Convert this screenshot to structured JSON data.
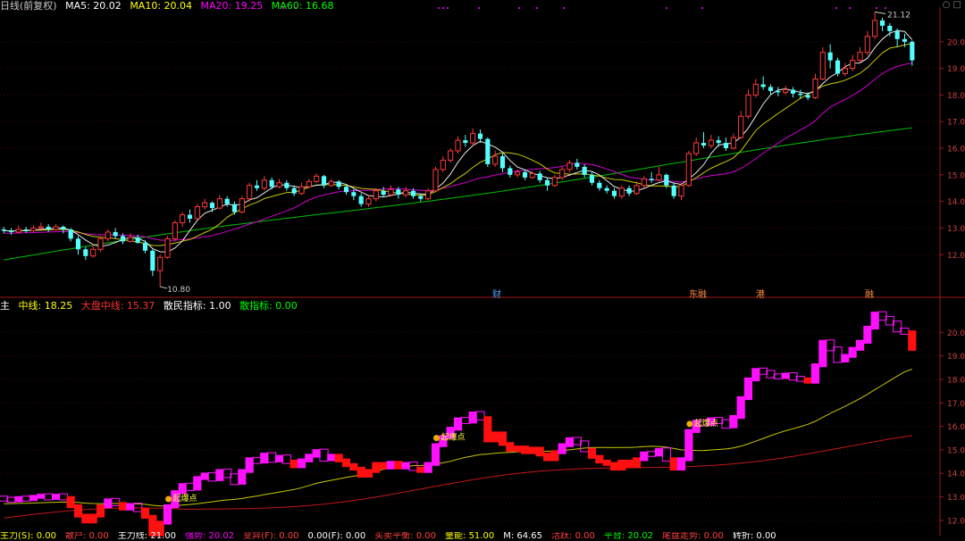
{
  "main_header": {
    "period": "日线(前复权)",
    "ma5": "MA5: 20.02",
    "ma10": "MA10: 20.04",
    "ma20": "MA20: 19.25",
    "ma60": "MA60: 16.68",
    "colors": {
      "period": "#c8c8c8",
      "ma5": "#ffffff",
      "ma10": "#ffff00",
      "ma20": "#ff00ff",
      "ma60": "#00ff00"
    }
  },
  "sub_header": {
    "name": "主",
    "mid": "中线: 18.25",
    "big": "大盘中线: 15.37",
    "retail": "散民指标: 1.00",
    "main_force": "散指标: 0.00",
    "colors": {
      "mid": "#ffff00",
      "big": "#ff3030",
      "retail": "#ffffff",
      "main_force": "#00ff00"
    }
  },
  "event_tags": [
    {
      "label": "财",
      "color": "#4fa3ff"
    },
    {
      "label": "东融",
      "color": "#ff8c40"
    },
    {
      "label": "港",
      "color": "#ff8c40"
    },
    {
      "label": "融",
      "color": "#ff8c40"
    }
  ],
  "annotations": {
    "high": "21.12",
    "low": "10.80",
    "signal_label": "起爆点"
  },
  "price_axis_main": [
    "20.00",
    "19.00",
    "18.00",
    "17.00",
    "16.00",
    "15.00",
    "14.00",
    "13.00",
    "12.00"
  ],
  "price_axis_sub": [
    "20.00",
    "19.00",
    "18.00",
    "17.00",
    "16.00",
    "15.00",
    "14.00",
    "13.00",
    "12.00"
  ],
  "bottom_bar": {
    "items": [
      "主力(S): 0.00",
      "散户: 0.00",
      "主力线: 21.00",
      "强势: 20.02",
      "变异(F): 0.00",
      "0.00(F): 0.00",
      "买卖平衡: 0.00",
      "量能: 51.00",
      "M: 64.65",
      "活跃: 0.00",
      "平台: 20.02",
      "尾盘走势: 0.00",
      "转折: 0.00"
    ]
  },
  "chart_data": {
    "type": "candlestick",
    "y_range_main": [
      10.5,
      21.3
    ],
    "y_range_sub": [
      11.5,
      21.0
    ],
    "candles": [
      [
        12.95,
        12.9,
        13.05,
        12.8
      ],
      [
        12.9,
        12.85,
        13.0,
        12.75
      ],
      [
        12.85,
        12.95,
        13.1,
        12.8
      ],
      [
        12.95,
        12.9,
        13.05,
        12.82
      ],
      [
        12.9,
        13.0,
        13.1,
        12.85
      ],
      [
        13.0,
        13.05,
        13.2,
        12.95
      ],
      [
        13.05,
        12.95,
        13.15,
        12.85
      ],
      [
        12.95,
        13.05,
        13.15,
        12.9
      ],
      [
        13.05,
        12.95,
        13.1,
        12.8
      ],
      [
        12.95,
        12.6,
        13.0,
        12.5
      ],
      [
        12.6,
        12.2,
        12.7,
        12.0
      ],
      [
        12.2,
        11.95,
        12.3,
        11.8
      ],
      [
        11.95,
        12.2,
        12.4,
        11.9
      ],
      [
        12.2,
        12.6,
        12.7,
        12.1
      ],
      [
        12.6,
        12.85,
        12.95,
        12.5
      ],
      [
        12.85,
        12.7,
        13.0,
        12.6
      ],
      [
        12.7,
        12.5,
        12.8,
        12.4
      ],
      [
        12.5,
        12.65,
        12.8,
        12.45
      ],
      [
        12.65,
        12.45,
        12.75,
        12.4
      ],
      [
        12.45,
        12.15,
        12.55,
        12.05
      ],
      [
        12.15,
        11.4,
        12.2,
        11.2
      ],
      [
        11.4,
        11.9,
        12.0,
        10.8
      ],
      [
        11.9,
        12.6,
        12.7,
        11.85
      ],
      [
        12.6,
        13.2,
        13.3,
        12.5
      ],
      [
        13.2,
        13.5,
        13.6,
        13.05
      ],
      [
        13.5,
        13.35,
        13.7,
        13.2
      ],
      [
        13.35,
        13.8,
        13.9,
        13.3
      ],
      [
        13.8,
        13.95,
        14.1,
        13.7
      ],
      [
        13.95,
        13.75,
        14.0,
        13.6
      ],
      [
        13.75,
        14.1,
        14.25,
        13.7
      ],
      [
        14.1,
        13.9,
        14.2,
        13.8
      ],
      [
        13.9,
        13.6,
        14.0,
        13.5
      ],
      [
        13.6,
        14.1,
        14.2,
        13.55
      ],
      [
        14.1,
        14.6,
        14.7,
        14.0
      ],
      [
        14.6,
        14.5,
        14.8,
        14.4
      ],
      [
        14.5,
        14.8,
        14.95,
        14.4
      ],
      [
        14.8,
        14.55,
        14.9,
        14.45
      ],
      [
        14.55,
        14.7,
        14.85,
        14.5
      ],
      [
        14.7,
        14.5,
        14.8,
        14.4
      ],
      [
        14.5,
        14.3,
        14.6,
        14.2
      ],
      [
        14.3,
        14.55,
        14.7,
        14.25
      ],
      [
        14.55,
        14.75,
        14.85,
        14.5
      ],
      [
        14.75,
        14.95,
        15.05,
        14.7
      ],
      [
        14.95,
        14.6,
        15.0,
        14.5
      ],
      [
        14.6,
        14.75,
        14.85,
        14.55
      ],
      [
        14.75,
        14.55,
        14.8,
        14.45
      ],
      [
        14.55,
        14.35,
        14.6,
        14.25
      ],
      [
        14.35,
        14.2,
        14.45,
        14.05
      ],
      [
        14.2,
        13.9,
        14.3,
        13.8
      ],
      [
        13.9,
        14.1,
        14.25,
        13.8
      ],
      [
        14.1,
        14.4,
        14.5,
        14.0
      ],
      [
        14.4,
        14.25,
        14.55,
        14.15
      ],
      [
        14.25,
        14.45,
        14.6,
        14.2
      ],
      [
        14.45,
        14.25,
        14.55,
        14.1
      ],
      [
        14.25,
        14.4,
        14.55,
        14.15
      ],
      [
        14.4,
        14.2,
        14.5,
        14.1
      ],
      [
        14.2,
        14.1,
        14.3,
        14.0
      ],
      [
        14.1,
        14.4,
        14.5,
        14.05
      ],
      [
        14.4,
        15.2,
        15.3,
        14.35
      ],
      [
        15.2,
        15.55,
        15.7,
        15.1
      ],
      [
        15.55,
        15.9,
        16.0,
        15.45
      ],
      [
        15.9,
        16.3,
        16.45,
        15.8
      ],
      [
        16.3,
        16.2,
        16.5,
        16.05
      ],
      [
        16.2,
        16.55,
        16.75,
        16.1
      ],
      [
        16.55,
        16.35,
        16.7,
        16.2
      ],
      [
        16.35,
        15.4,
        16.4,
        15.3
      ],
      [
        15.4,
        15.7,
        15.9,
        15.3
      ],
      [
        15.7,
        15.25,
        15.8,
        15.1
      ],
      [
        15.25,
        15.0,
        15.35,
        14.9
      ],
      [
        15.0,
        15.1,
        15.2,
        14.9
      ],
      [
        15.1,
        14.9,
        15.2,
        14.8
      ],
      [
        14.9,
        15.05,
        15.15,
        14.85
      ],
      [
        15.05,
        14.8,
        15.15,
        14.7
      ],
      [
        14.8,
        14.6,
        14.9,
        14.4
      ],
      [
        14.6,
        14.9,
        15.0,
        14.55
      ],
      [
        14.9,
        15.2,
        15.3,
        14.8
      ],
      [
        15.2,
        15.45,
        15.55,
        15.1
      ],
      [
        15.45,
        15.3,
        15.6,
        15.2
      ],
      [
        15.3,
        15.0,
        15.4,
        14.9
      ],
      [
        15.0,
        14.7,
        15.1,
        14.6
      ],
      [
        14.7,
        14.5,
        14.8,
        14.4
      ],
      [
        14.5,
        14.4,
        14.6,
        14.3
      ],
      [
        14.4,
        14.2,
        14.5,
        14.1
      ],
      [
        14.2,
        14.5,
        14.6,
        14.1
      ],
      [
        14.5,
        14.3,
        14.6,
        14.2
      ],
      [
        14.3,
        14.6,
        14.75,
        14.25
      ],
      [
        14.6,
        14.85,
        14.95,
        14.5
      ],
      [
        14.85,
        14.8,
        15.1,
        14.7
      ],
      [
        14.8,
        15.0,
        15.3,
        14.75
      ],
      [
        15.0,
        14.6,
        15.05,
        14.5
      ],
      [
        14.6,
        14.2,
        14.7,
        14.1
      ],
      [
        14.2,
        14.6,
        14.7,
        14.05
      ],
      [
        14.6,
        15.8,
        15.9,
        14.55
      ],
      [
        15.8,
        16.2,
        16.4,
        15.7
      ],
      [
        16.2,
        16.1,
        16.6,
        16.0
      ],
      [
        16.1,
        16.3,
        16.5,
        16.0
      ],
      [
        16.3,
        16.2,
        16.45,
        16.05
      ],
      [
        16.2,
        16.0,
        16.4,
        15.9
      ],
      [
        16.0,
        16.4,
        16.55,
        15.95
      ],
      [
        16.4,
        17.2,
        17.4,
        16.35
      ],
      [
        17.2,
        18.0,
        18.2,
        17.1
      ],
      [
        18.0,
        18.4,
        18.6,
        17.9
      ],
      [
        18.4,
        18.3,
        18.7,
        18.2
      ],
      [
        18.3,
        18.15,
        18.4,
        18.0
      ],
      [
        18.15,
        18.1,
        18.3,
        17.95
      ],
      [
        18.1,
        18.2,
        18.35,
        18.0
      ],
      [
        18.2,
        18.05,
        18.3,
        17.9
      ],
      [
        18.05,
        18.0,
        18.2,
        17.85
      ],
      [
        18.0,
        17.9,
        18.1,
        17.8
      ],
      [
        17.9,
        18.6,
        18.8,
        17.85
      ],
      [
        18.6,
        19.6,
        19.8,
        18.55
      ],
      [
        19.6,
        19.3,
        19.9,
        19.0
      ],
      [
        19.3,
        18.8,
        19.4,
        18.7
      ],
      [
        18.8,
        19.0,
        19.2,
        18.7
      ],
      [
        19.0,
        19.3,
        19.5,
        18.9
      ],
      [
        19.3,
        19.6,
        19.8,
        19.2
      ],
      [
        19.6,
        20.2,
        20.4,
        19.5
      ],
      [
        20.2,
        20.8,
        21.12,
        20.1
      ],
      [
        20.8,
        20.6,
        20.9,
        20.4
      ],
      [
        20.6,
        20.4,
        20.7,
        20.2
      ],
      [
        20.4,
        20.1,
        20.5,
        19.8
      ],
      [
        20.1,
        20.0,
        20.3,
        19.8
      ],
      [
        20.0,
        19.3,
        20.05,
        19.1
      ]
    ]
  }
}
